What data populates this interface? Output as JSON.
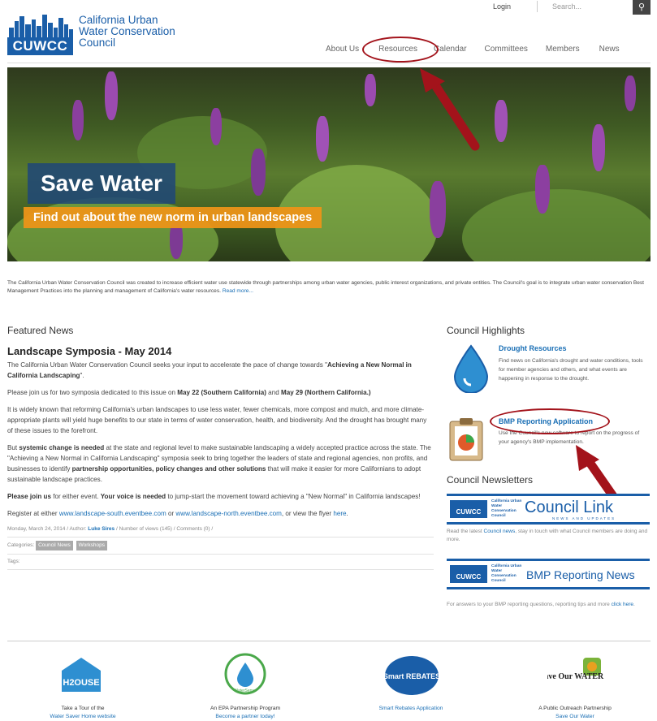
{
  "header": {
    "org_line1": "California Urban",
    "org_line2": "Water Conservation",
    "org_line3": "Council",
    "logo_badge": "CUWCC",
    "login": "Login",
    "search_placeholder": "Search...",
    "nav": [
      "About Us",
      "Resources",
      "Calendar",
      "Committees",
      "Members",
      "News"
    ]
  },
  "hero": {
    "title": "Save Water",
    "subtitle": "Find out about the new norm in urban landscapes"
  },
  "intro": {
    "text": "The California Urban Water Conservation Council was created to increase efficient water use statewide through partnerships among urban water agencies, public interest organizations, and private entities. The Council's goal is to integrate urban water conservation Best Management Practices into the planning and management of California's water resources.",
    "read_more": "Read more..."
  },
  "featured": {
    "heading": "Featured News",
    "article_title": "Landscape Symposia - May 2014",
    "p1_a": "The California Urban Water Conservation Council seeks your input to accelerate the pace of change towards \"",
    "p1_b": "Achieving a New Normal in California Landscaping",
    "p1_c": "\".",
    "p2_a": "Please join us for two symposia dedicated to this issue on ",
    "p2_b": "May 22 (Southern California)",
    "p2_c": " and ",
    "p2_d": "May 29 (Northern California.)",
    "p3": "It is widely known that reforming California's urban landscapes to use less water, fewer chemicals, more compost and mulch, and more climate-appropriate plants will yield huge benefits to our state in terms of water conservation, health, and biodiversity. And the drought has brought many of these issues to the forefront.",
    "p4_a": "But ",
    "p4_b": "systemic change is needed",
    "p4_c": " at the state and regional level to make sustainable landscaping a widely accepted practice across the state. The \"Achieving a New Normal in California Landscaping\" symposia seek to bring together the leaders of state and regional agencies, non profits, and businesses to identify ",
    "p4_d": "partnership opportunities, policy changes and other solutions",
    "p4_e": " that will make it easier for more Californians to adopt sustainable landscape practices.",
    "p5_a": "Please join us",
    "p5_b": " for either event. ",
    "p5_c": "Your voice is needed",
    "p5_d": " to jump-start the movement toward achieving a \"New Normal\" in California landscapes!",
    "p6_a": "Register at either ",
    "p6_link1": "www.landscape-south.eventbee.com",
    "p6_b": " or ",
    "p6_link2": "www.landscape-north.eventbee.com",
    "p6_c": ", or view the flyer ",
    "p6_link3": "here",
    "p6_d": ".",
    "meta_date": "Monday, March 24, 2014",
    "meta_author_label": "Author:",
    "meta_author": "Luke Sires",
    "meta_views": "Number of views (145)",
    "meta_comments": "Comments (0)",
    "categories_label": "Categories:",
    "categories": [
      "Council News",
      "Workshops"
    ],
    "tags_label": "Tags:"
  },
  "sidebar": {
    "highlights_heading": "Council Highlights",
    "drought_title": "Drought Resources",
    "drought_desc": "Find news on California's drought and water conditions, tools for member agencies and others, and what events are happening in response to the drought.",
    "bmp_title": "BMP Reporting Application",
    "bmp_desc": "Use the Council's new software to report on the progress of your agency's BMP implementation.",
    "newsletters_heading": "Council Newsletters",
    "councillink_text": "Council Link",
    "councillink_sub": "NEWS AND UPDATES",
    "cl_note_a": "Read the latest ",
    "cl_note_link": "Council news",
    "cl_note_b": ", stay in touch with what Council members are doing and more.",
    "bmpnews_text": "BMP Reporting News",
    "bmp_note_a": "For answers to your BMP reporting questions, reporting tips and more ",
    "bmp_note_link": "click here",
    "bmp_note_b": ".",
    "mini_org": "California Urban Water Conservation Council",
    "mini_badge": "CUWCC"
  },
  "footer": {
    "partners": [
      {
        "line1": "Take a Tour of the",
        "line2": "Water Saver Home website",
        "logo": "H2OUSE"
      },
      {
        "line1": "An EPA Partnership Program",
        "line2": "Become a partner today!",
        "logo": "WaterSense"
      },
      {
        "line1": "",
        "line2": "Smart Rebates Application",
        "logo": "Smart REBATES"
      },
      {
        "line1": "A Public Outreach Partnership",
        "line2": "Save Our Water",
        "logo": "Save Our WATER"
      }
    ]
  },
  "colors": {
    "brand_blue": "#1a5ea8",
    "link_blue": "#1a6fb5",
    "accent_orange": "#ec9418",
    "annotation_red": "#a3131b"
  }
}
